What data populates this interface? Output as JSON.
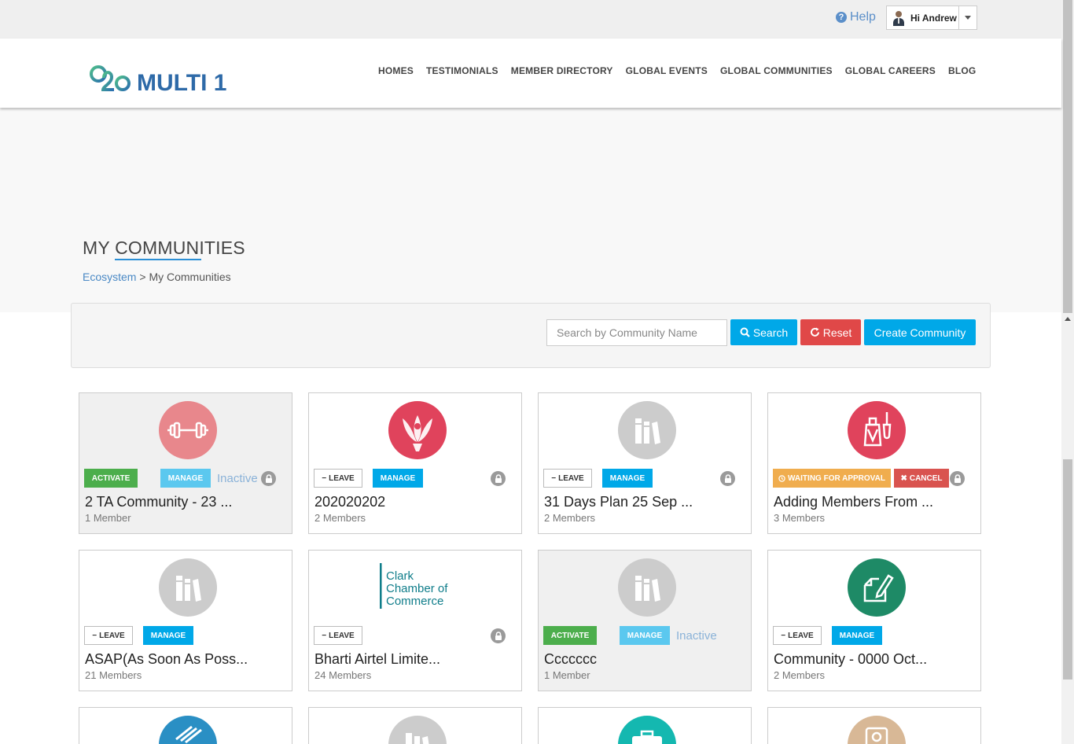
{
  "topbar": {
    "help_label": "Help",
    "user_greeting": "Hi Andrew"
  },
  "header": {
    "logo_text": "MULTI 1",
    "nav": [
      "HOMES",
      "TESTIMONIALS",
      "MEMBER DIRECTORY",
      "GLOBAL EVENTS",
      "GLOBAL COMMUNITIES",
      "GLOBAL CAREERS",
      "BLOG"
    ]
  },
  "page": {
    "title": "MY COMMUNITIES",
    "breadcrumb_link": "Ecosystem",
    "breadcrumb_sep": ">",
    "breadcrumb_current": "My Communities"
  },
  "search": {
    "placeholder": "Search by Community Name",
    "search_label": "Search",
    "reset_label": "Reset",
    "create_label": "Create Community"
  },
  "cards": [
    {
      "name": "2 TA Community - 23 ...",
      "members": "1 Member",
      "icon": "dumbbell-icon",
      "icon_color": "#e8878c"
    },
    {
      "name": "202020202",
      "members": "2 Members",
      "icon": "lotus-icon",
      "icon_color": "#e0435c"
    },
    {
      "name": "31 Days Plan 25 Sep ...",
      "members": "2 Members",
      "icon": "books-icon",
      "icon_color": "#cccccc"
    },
    {
      "name": "Adding Members From ...",
      "members": "3 Members",
      "icon": "nail-polish-icon",
      "icon_color": "#e0435c"
    },
    {
      "name": "ASAP(As Soon As Poss...",
      "members": "21 Members",
      "icon": "books-icon",
      "icon_color": "#cccccc"
    },
    {
      "name": "Bharti Airtel Limite...",
      "members": "24 Members",
      "icon": "clark-chamber-logo",
      "logo_lines": [
        "Clark",
        "Chamber of",
        "Commerce"
      ]
    },
    {
      "name": "Ccccccc",
      "members": "1 Member",
      "icon": "books-icon",
      "icon_color": "#cccccc"
    },
    {
      "name": "Community - 0000 Oct...",
      "members": "2 Members",
      "icon": "edit-note-icon",
      "icon_color": "#1e8a66"
    }
  ],
  "badges": {
    "activate": "ACTIVATE",
    "manage": "MANAGE",
    "leave": "LEAVE",
    "waiting": "WAITING FOR APPROVAL",
    "cancel": "CANCEL",
    "inactive": "Inactive"
  },
  "partial_row_icon_colors": [
    "#2a8fc4",
    "#cccccc",
    "#14b8b0",
    "#d8b896"
  ]
}
